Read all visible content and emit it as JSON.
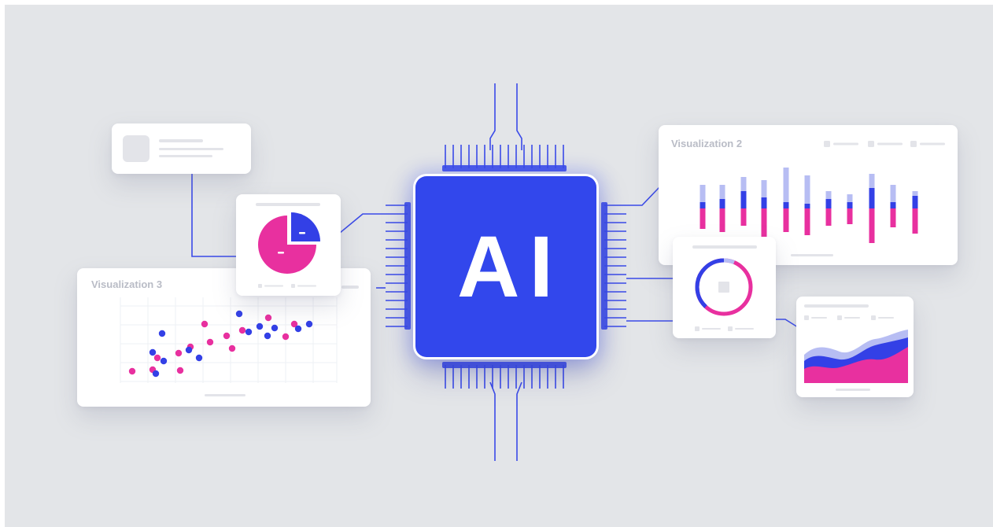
{
  "chip": {
    "label": "AI"
  },
  "cards": {
    "viz2": {
      "title": "Visualization 2"
    },
    "viz3": {
      "title": "Visualization 3"
    }
  },
  "colors": {
    "background": "#e3e5e8",
    "chip": "#3247ec",
    "blue": "#3340e6",
    "light_blue": "#b7bdf3",
    "magenta": "#e8309f",
    "placeholder_gray": "#e3e4e9"
  },
  "icons": [
    "avatar-placeholder",
    "pie-chart",
    "bar-chart",
    "donut-chart",
    "area-chart",
    "scatter-plot",
    "circuit-lines"
  ]
}
